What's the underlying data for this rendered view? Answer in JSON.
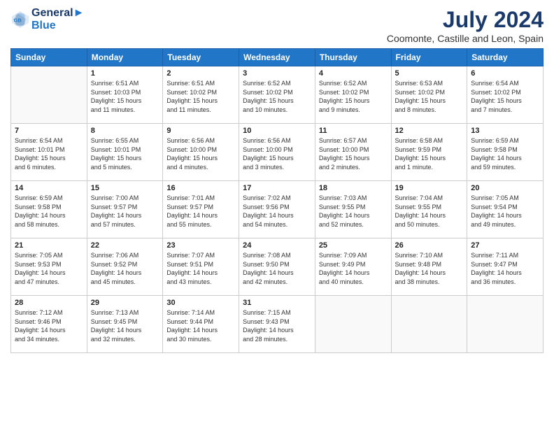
{
  "header": {
    "logo_line1": "General",
    "logo_line2": "Blue",
    "month_year": "July 2024",
    "location": "Coomonte, Castille and Leon, Spain"
  },
  "weekdays": [
    "Sunday",
    "Monday",
    "Tuesday",
    "Wednesday",
    "Thursday",
    "Friday",
    "Saturday"
  ],
  "weeks": [
    [
      {
        "day": "",
        "info": ""
      },
      {
        "day": "1",
        "info": "Sunrise: 6:51 AM\nSunset: 10:03 PM\nDaylight: 15 hours\nand 11 minutes."
      },
      {
        "day": "2",
        "info": "Sunrise: 6:51 AM\nSunset: 10:02 PM\nDaylight: 15 hours\nand 11 minutes."
      },
      {
        "day": "3",
        "info": "Sunrise: 6:52 AM\nSunset: 10:02 PM\nDaylight: 15 hours\nand 10 minutes."
      },
      {
        "day": "4",
        "info": "Sunrise: 6:52 AM\nSunset: 10:02 PM\nDaylight: 15 hours\nand 9 minutes."
      },
      {
        "day": "5",
        "info": "Sunrise: 6:53 AM\nSunset: 10:02 PM\nDaylight: 15 hours\nand 8 minutes."
      },
      {
        "day": "6",
        "info": "Sunrise: 6:54 AM\nSunset: 10:02 PM\nDaylight: 15 hours\nand 7 minutes."
      }
    ],
    [
      {
        "day": "7",
        "info": "Sunrise: 6:54 AM\nSunset: 10:01 PM\nDaylight: 15 hours\nand 6 minutes."
      },
      {
        "day": "8",
        "info": "Sunrise: 6:55 AM\nSunset: 10:01 PM\nDaylight: 15 hours\nand 5 minutes."
      },
      {
        "day": "9",
        "info": "Sunrise: 6:56 AM\nSunset: 10:00 PM\nDaylight: 15 hours\nand 4 minutes."
      },
      {
        "day": "10",
        "info": "Sunrise: 6:56 AM\nSunset: 10:00 PM\nDaylight: 15 hours\nand 3 minutes."
      },
      {
        "day": "11",
        "info": "Sunrise: 6:57 AM\nSunset: 10:00 PM\nDaylight: 15 hours\nand 2 minutes."
      },
      {
        "day": "12",
        "info": "Sunrise: 6:58 AM\nSunset: 9:59 PM\nDaylight: 15 hours\nand 1 minute."
      },
      {
        "day": "13",
        "info": "Sunrise: 6:59 AM\nSunset: 9:58 PM\nDaylight: 14 hours\nand 59 minutes."
      }
    ],
    [
      {
        "day": "14",
        "info": "Sunrise: 6:59 AM\nSunset: 9:58 PM\nDaylight: 14 hours\nand 58 minutes."
      },
      {
        "day": "15",
        "info": "Sunrise: 7:00 AM\nSunset: 9:57 PM\nDaylight: 14 hours\nand 57 minutes."
      },
      {
        "day": "16",
        "info": "Sunrise: 7:01 AM\nSunset: 9:57 PM\nDaylight: 14 hours\nand 55 minutes."
      },
      {
        "day": "17",
        "info": "Sunrise: 7:02 AM\nSunset: 9:56 PM\nDaylight: 14 hours\nand 54 minutes."
      },
      {
        "day": "18",
        "info": "Sunrise: 7:03 AM\nSunset: 9:55 PM\nDaylight: 14 hours\nand 52 minutes."
      },
      {
        "day": "19",
        "info": "Sunrise: 7:04 AM\nSunset: 9:55 PM\nDaylight: 14 hours\nand 50 minutes."
      },
      {
        "day": "20",
        "info": "Sunrise: 7:05 AM\nSunset: 9:54 PM\nDaylight: 14 hours\nand 49 minutes."
      }
    ],
    [
      {
        "day": "21",
        "info": "Sunrise: 7:05 AM\nSunset: 9:53 PM\nDaylight: 14 hours\nand 47 minutes."
      },
      {
        "day": "22",
        "info": "Sunrise: 7:06 AM\nSunset: 9:52 PM\nDaylight: 14 hours\nand 45 minutes."
      },
      {
        "day": "23",
        "info": "Sunrise: 7:07 AM\nSunset: 9:51 PM\nDaylight: 14 hours\nand 43 minutes."
      },
      {
        "day": "24",
        "info": "Sunrise: 7:08 AM\nSunset: 9:50 PM\nDaylight: 14 hours\nand 42 minutes."
      },
      {
        "day": "25",
        "info": "Sunrise: 7:09 AM\nSunset: 9:49 PM\nDaylight: 14 hours\nand 40 minutes."
      },
      {
        "day": "26",
        "info": "Sunrise: 7:10 AM\nSunset: 9:48 PM\nDaylight: 14 hours\nand 38 minutes."
      },
      {
        "day": "27",
        "info": "Sunrise: 7:11 AM\nSunset: 9:47 PM\nDaylight: 14 hours\nand 36 minutes."
      }
    ],
    [
      {
        "day": "28",
        "info": "Sunrise: 7:12 AM\nSunset: 9:46 PM\nDaylight: 14 hours\nand 34 minutes."
      },
      {
        "day": "29",
        "info": "Sunrise: 7:13 AM\nSunset: 9:45 PM\nDaylight: 14 hours\nand 32 minutes."
      },
      {
        "day": "30",
        "info": "Sunrise: 7:14 AM\nSunset: 9:44 PM\nDaylight: 14 hours\nand 30 minutes."
      },
      {
        "day": "31",
        "info": "Sunrise: 7:15 AM\nSunset: 9:43 PM\nDaylight: 14 hours\nand 28 minutes."
      },
      {
        "day": "",
        "info": ""
      },
      {
        "day": "",
        "info": ""
      },
      {
        "day": "",
        "info": ""
      }
    ]
  ]
}
